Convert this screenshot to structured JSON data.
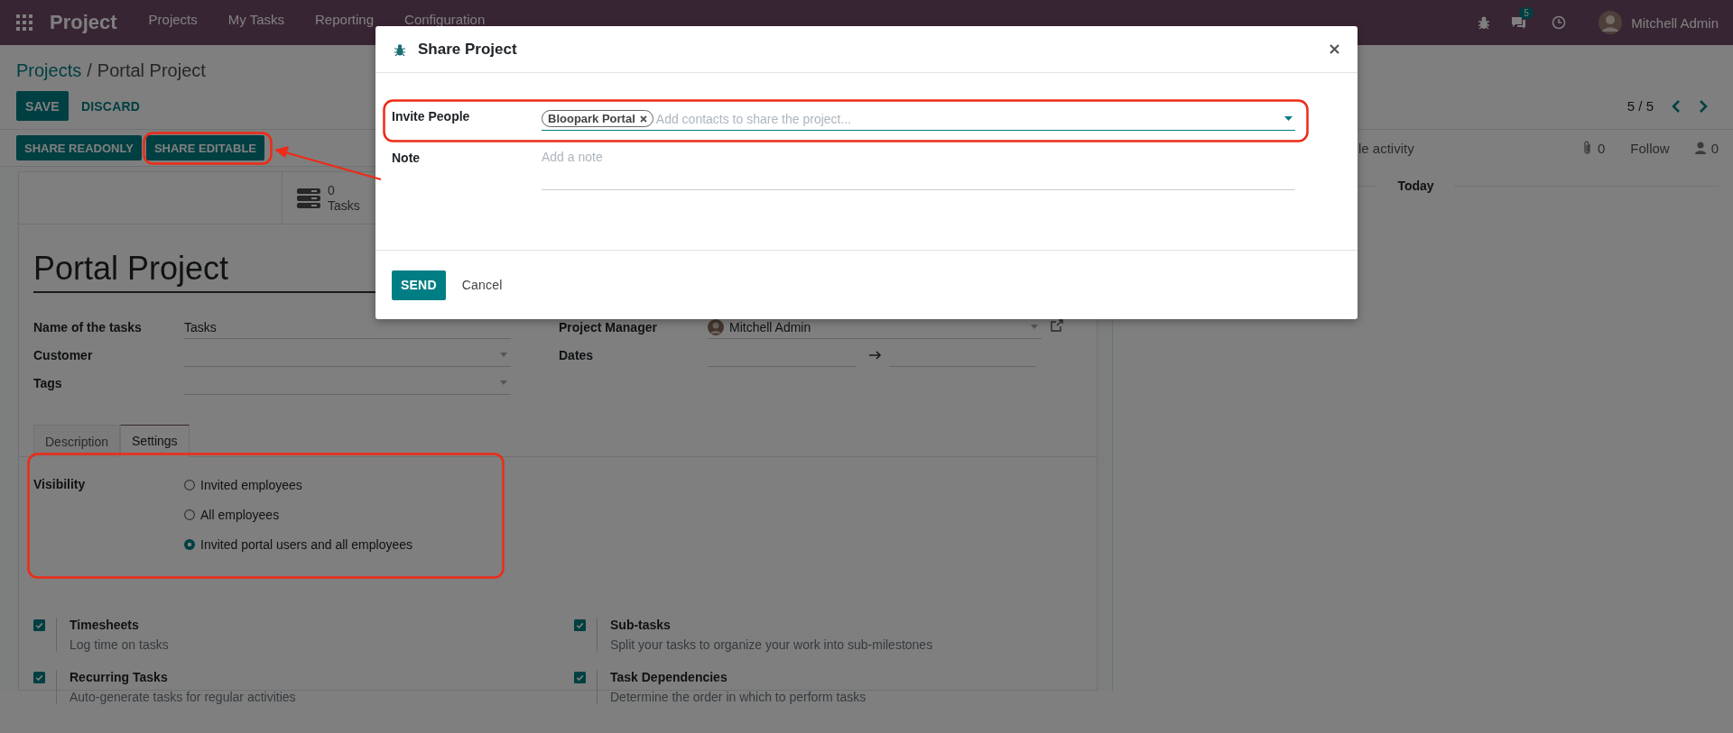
{
  "navbar": {
    "app_name": "Project",
    "menu": [
      "Projects",
      "My Tasks",
      "Reporting",
      "Configuration"
    ],
    "chat_count": "5",
    "user": "Mitchell Admin"
  },
  "breadcrumb": {
    "parent": "Projects",
    "separator": "/",
    "current": "Portal Project"
  },
  "form_buttons": [
    "SAVE",
    "DISCARD"
  ],
  "pager": "5 / 5",
  "header_buttons": [
    "SHARE READONLY",
    "SHARE EDITABLE"
  ],
  "stat_button": {
    "value": "0",
    "label": "Tasks"
  },
  "project_name": "Portal Project",
  "fields_left": [
    {
      "label": "Name of the tasks",
      "value": "Tasks",
      "kind": "text"
    },
    {
      "label": "Customer",
      "kind": "select"
    },
    {
      "label": "Tags",
      "kind": "select"
    }
  ],
  "fields_right": [
    {
      "label": "Project Manager",
      "value": "Mitchell Admin",
      "kind": "user"
    },
    {
      "label": "Dates",
      "kind": "range"
    }
  ],
  "tabs": [
    {
      "label": "Description",
      "selected": false
    },
    {
      "label": "Settings",
      "selected": true
    }
  ],
  "visibility": {
    "label": "Visibility",
    "options": [
      {
        "label": "Invited employees",
        "selected": false
      },
      {
        "label": "All employees",
        "selected": false
      },
      {
        "label": "Invited portal users and all employees",
        "selected": true
      }
    ]
  },
  "features": [
    {
      "title": "Timesheets",
      "description": "Log time on tasks",
      "checked": true
    },
    {
      "title": "Sub-tasks",
      "description": "Split your tasks to organize your work into sub-milestones",
      "checked": true
    },
    {
      "title": "Recurring Tasks",
      "description": "Auto-generate tasks for regular activities",
      "checked": true
    },
    {
      "title": "Task Dependencies",
      "description": "Determine the order in which to perform tasks",
      "checked": true
    }
  ],
  "chatter": {
    "activity": "le activity",
    "attachments": "0",
    "follow": "Follow",
    "followers": "0",
    "separator": "Today"
  },
  "dialog": {
    "title": "Share Project",
    "invite_label": "Invite People",
    "tags": [
      "Bloopark Portal"
    ],
    "invite_placeholder": "Add contacts to share the project...",
    "note_label": "Note",
    "note_placeholder": "Add a note",
    "send": "SEND",
    "cancel": "Cancel"
  }
}
